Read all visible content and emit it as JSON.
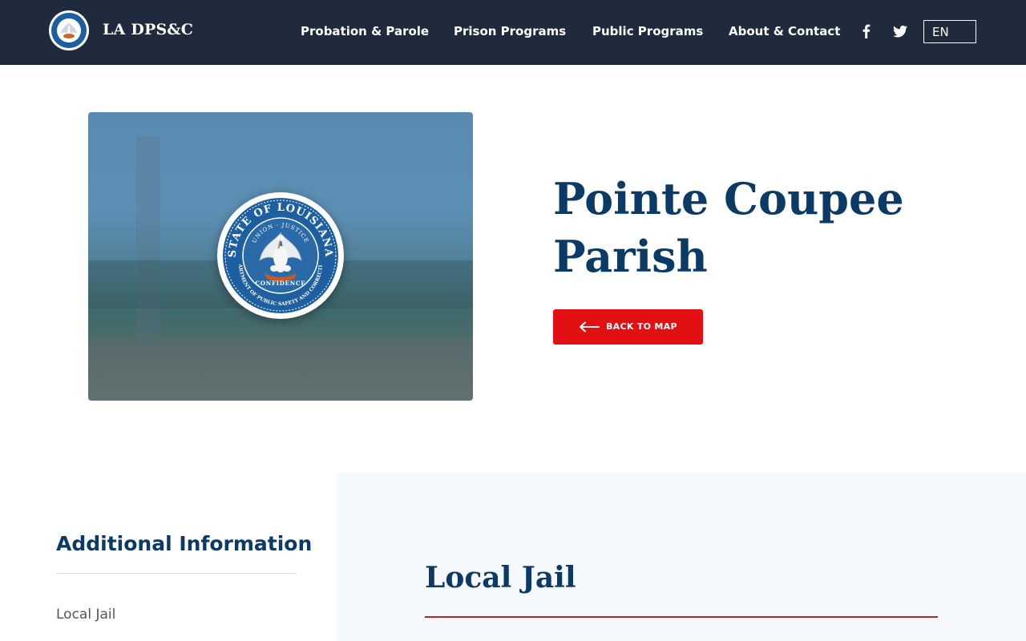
{
  "header": {
    "brand": "LA DPS&C",
    "nav": [
      {
        "label": "Probation & Parole"
      },
      {
        "label": "Prison Programs"
      },
      {
        "label": "Public Programs"
      },
      {
        "label": "About & Contact"
      }
    ],
    "social": [
      "facebook-icon",
      "twitter-icon"
    ],
    "language": "EN"
  },
  "hero": {
    "title": "Pointe Coupee Parish",
    "back_button": "BACK TO MAP",
    "seal": {
      "top_text": "STATE OF LOUISIANA",
      "motto": "UNION · JUSTICE",
      "banner": "CONFIDENCE",
      "bottom_text": "DEPARTMENT OF PUBLIC SAFETY AND CORRECTIONS"
    }
  },
  "sidebar": {
    "title": "Additional Information",
    "links": [
      {
        "label": "Local Jail"
      }
    ]
  },
  "content": {
    "section_title": "Local Jail"
  },
  "colors": {
    "header_bg": "#1f2a3c",
    "navy": "#0c3a66",
    "accent_red": "#e31013",
    "panel_bg": "#f5f8fc"
  }
}
